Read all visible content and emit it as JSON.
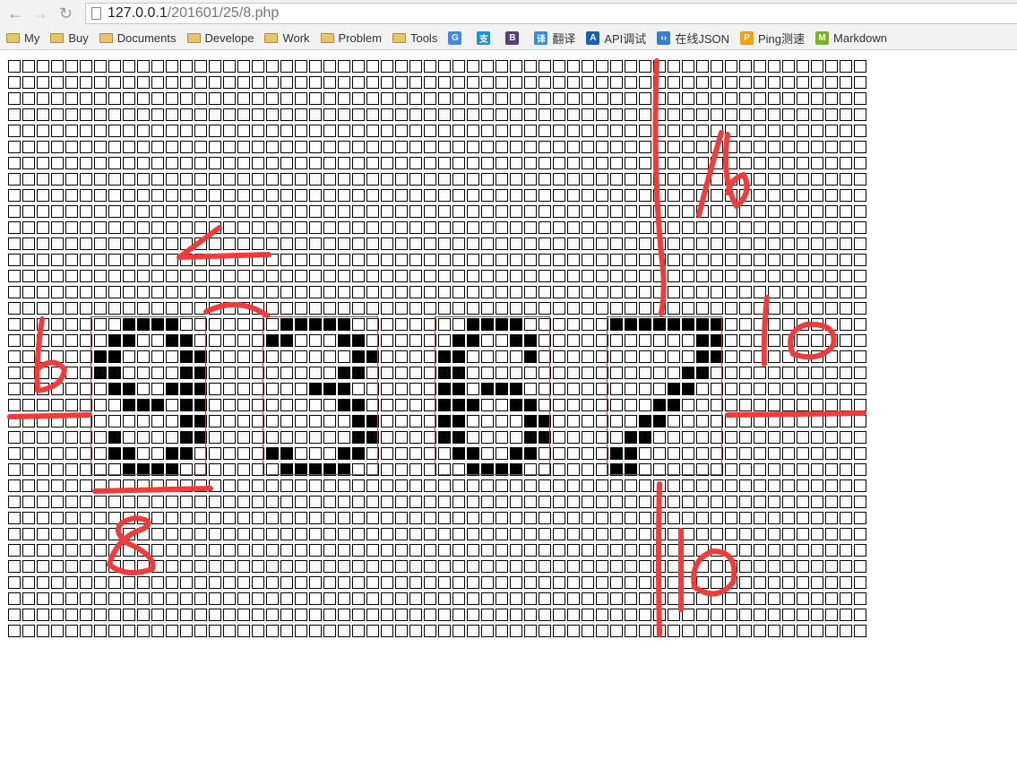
{
  "browser": {
    "url_host": "127.0.0.1",
    "url_path": "/201601/25/8.php",
    "bookmarks": [
      {
        "label": "My",
        "icon": "folder-icon"
      },
      {
        "label": "Buy",
        "icon": "folder-icon"
      },
      {
        "label": "Documents",
        "icon": "folder-icon"
      },
      {
        "label": "Develope",
        "icon": "folder-icon"
      },
      {
        "label": "Work",
        "icon": "folder-icon"
      },
      {
        "label": "Problem",
        "icon": "folder-icon"
      },
      {
        "label": "Tools",
        "icon": "folder-icon"
      },
      {
        "label": "",
        "icon": "google-icon",
        "glyph": "G",
        "color": "#4285f4"
      },
      {
        "label": "",
        "icon": "alipay-icon",
        "glyph": "支",
        "color": "#1296db"
      },
      {
        "label": "",
        "icon": "bootstrap-icon",
        "glyph": "B",
        "color": "#563d7c"
      },
      {
        "label": "翻译",
        "icon": "translate-icon",
        "glyph": "译",
        "color": "#2d8cf0"
      },
      {
        "label": "API调试",
        "icon": "api-icon",
        "glyph": "A",
        "color": "#1a5fb4"
      },
      {
        "label": "在线JSON",
        "icon": "code-icon",
        "glyph": "‹›",
        "color": "#3a7bd5"
      },
      {
        "label": "Ping测速",
        "icon": "ping-icon",
        "glyph": "P",
        "color": "#f0a500"
      },
      {
        "label": "Markdown",
        "icon": "markdown-icon",
        "glyph": "M",
        "color": "#7cb518"
      }
    ]
  },
  "grid": {
    "cols": 60,
    "rows": 36,
    "digit_row": 16,
    "digits": [
      {
        "col": 6,
        "bitmap": [
          "..####..",
          ".##..##.",
          "##....##",
          "##....##",
          ".##..###",
          "..###.##",
          "......##",
          ".#....##",
          ".##..##.",
          "..####.."
        ]
      },
      {
        "col": 18,
        "bitmap": [
          ".#####..",
          "##...##.",
          "......##",
          ".....##.",
          "...###..",
          ".....##.",
          "......##",
          "......##",
          "##...##.",
          ".#####.."
        ]
      },
      {
        "col": 30,
        "bitmap": [
          "..####..",
          ".##..##.",
          "##....#.",
          "##......",
          "##.###..",
          "###..##.",
          "##....##",
          "##....##",
          ".##..##.",
          "..####.."
        ]
      },
      {
        "col": 42,
        "bitmap": [
          "########",
          "......##",
          "......##",
          ".....##.",
          "....##..",
          "...##...",
          "..##....",
          ".##.....",
          "##......",
          "##......"
        ]
      }
    ],
    "highlight_color": "#e53333"
  },
  "annotations": {
    "color": "#f53a3a",
    "labels": [
      "4",
      "6",
      "8",
      "16",
      "10",
      "10"
    ]
  }
}
